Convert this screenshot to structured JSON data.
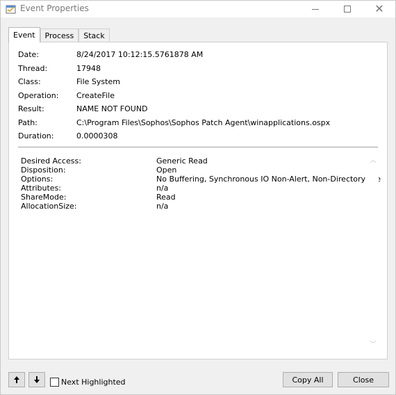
{
  "window": {
    "title": "Event Properties"
  },
  "tabs": [
    {
      "label": "Event",
      "active": true
    },
    {
      "label": "Process",
      "active": false
    },
    {
      "label": "Stack",
      "active": false
    }
  ],
  "event": [
    {
      "label": "Date:",
      "value": "8/24/2017 10:12:15.5761878 AM"
    },
    {
      "label": "Thread:",
      "value": "17948"
    },
    {
      "label": "Class:",
      "value": "File System"
    },
    {
      "label": "Operation:",
      "value": "CreateFile"
    },
    {
      "label": "Result:",
      "value": "NAME NOT FOUND"
    },
    {
      "label": "Path:",
      "value": "C:\\Program Files\\Sophos\\Sophos Patch Agent\\winapplications.ospx"
    },
    {
      "label": "Duration:",
      "value": "0.0000308"
    }
  ],
  "details": [
    {
      "label": "Desired Access:",
      "value": "Generic Read"
    },
    {
      "label": "Disposition:",
      "value": "Open"
    },
    {
      "label": "Options:",
      "value": "No Buffering, Synchronous IO Non-Alert, Non-Directory File"
    },
    {
      "label": "Attributes:",
      "value": "n/a"
    },
    {
      "label": "ShareMode:",
      "value": "Read"
    },
    {
      "label": "AllocationSize:",
      "value": "n/a"
    }
  ],
  "footer": {
    "next_highlighted_label": "Next Highlighted",
    "next_highlighted_checked": false,
    "copy_all_label": "Copy All",
    "close_label": "Close"
  },
  "icons": {
    "up": "arrow-up-icon",
    "down": "arrow-down-icon",
    "minimize": "minimize-icon",
    "maximize": "maximize-icon",
    "close": "close-icon"
  }
}
